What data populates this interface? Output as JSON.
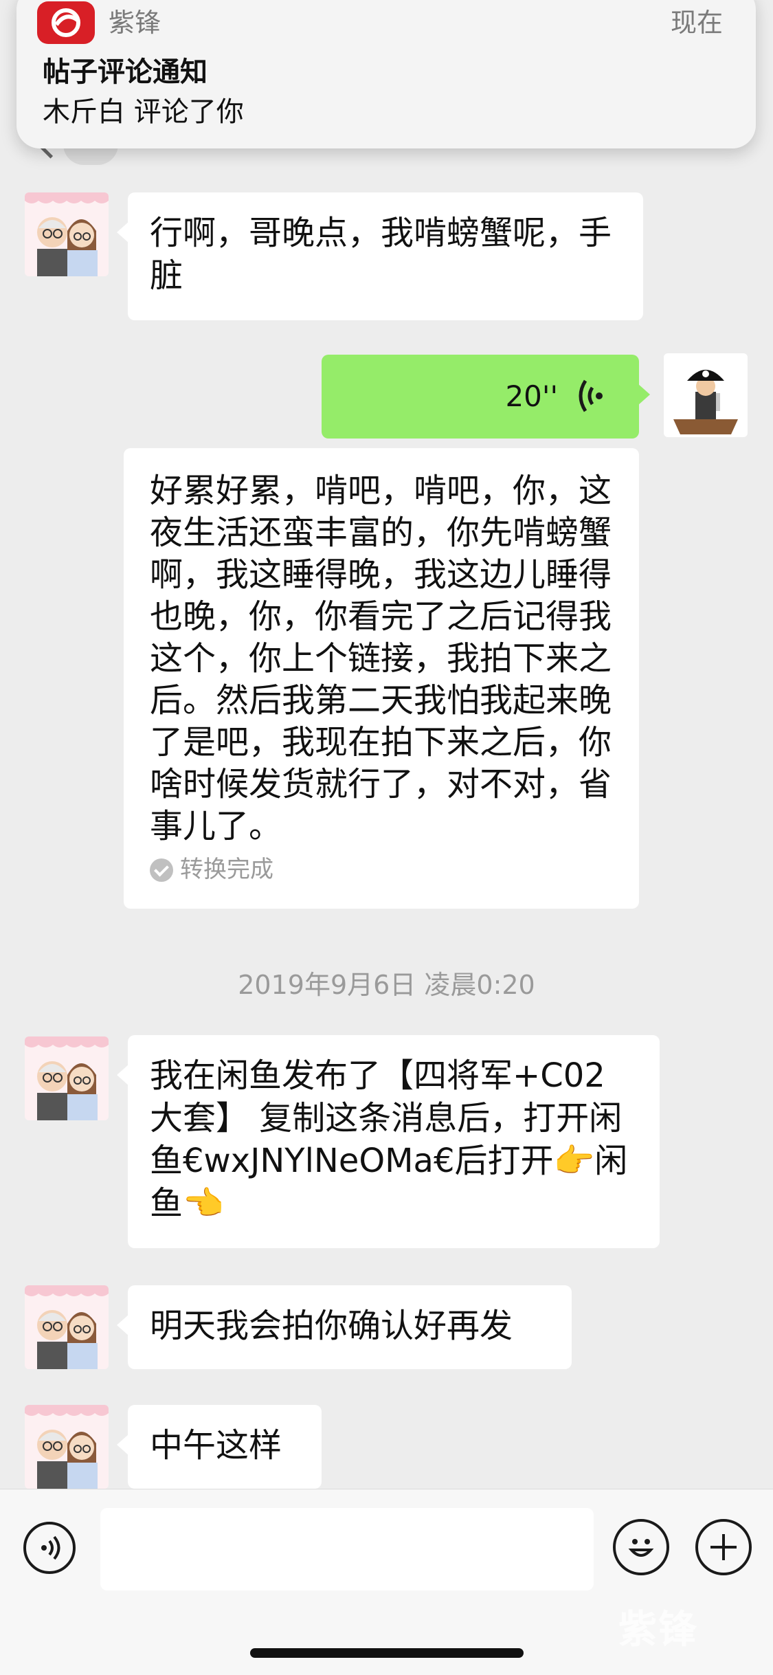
{
  "notification": {
    "app_name": "紫锋",
    "time": "现在",
    "title": "帖子评论通知",
    "body": "木斤白 评论了你"
  },
  "messages": [
    {
      "side": "left",
      "type": "text",
      "text": "行啊，哥晚点，我啃螃蟹呢，手脏"
    },
    {
      "side": "right",
      "type": "voice",
      "duration": "20''"
    },
    {
      "side": "right",
      "type": "transcript",
      "text": "好累好累，啃吧，啃吧，你，这夜生活还蛮丰富的，你先啃螃蟹啊，我这睡得晚，我这边儿睡得也晚，你，你看完了之后记得我这个，你上个链接，我拍下来之后。然后我第二天我怕我起来晚了是吧，我现在拍下来之后，你啥时候发货就行了，对不对，省事儿了。",
      "status": "转换完成"
    },
    {
      "side": "center",
      "type": "timestamp",
      "text": "2019年9月6日 凌晨0:20"
    },
    {
      "side": "left",
      "type": "text",
      "text": "我在闲鱼发布了【四将军+C02大套】 复制这条消息后，打开闲鱼€wxJNYlNeOMa€后打开👉闲鱼👈"
    },
    {
      "side": "left",
      "type": "text",
      "text": "明天我会拍你确认好再发"
    },
    {
      "side": "left",
      "type": "text",
      "text": "中午这样"
    }
  ],
  "watermark": "紫锋",
  "colors": {
    "bubble_green": "#95ec69",
    "background": "#ededed",
    "app_red": "#d81f26"
  }
}
